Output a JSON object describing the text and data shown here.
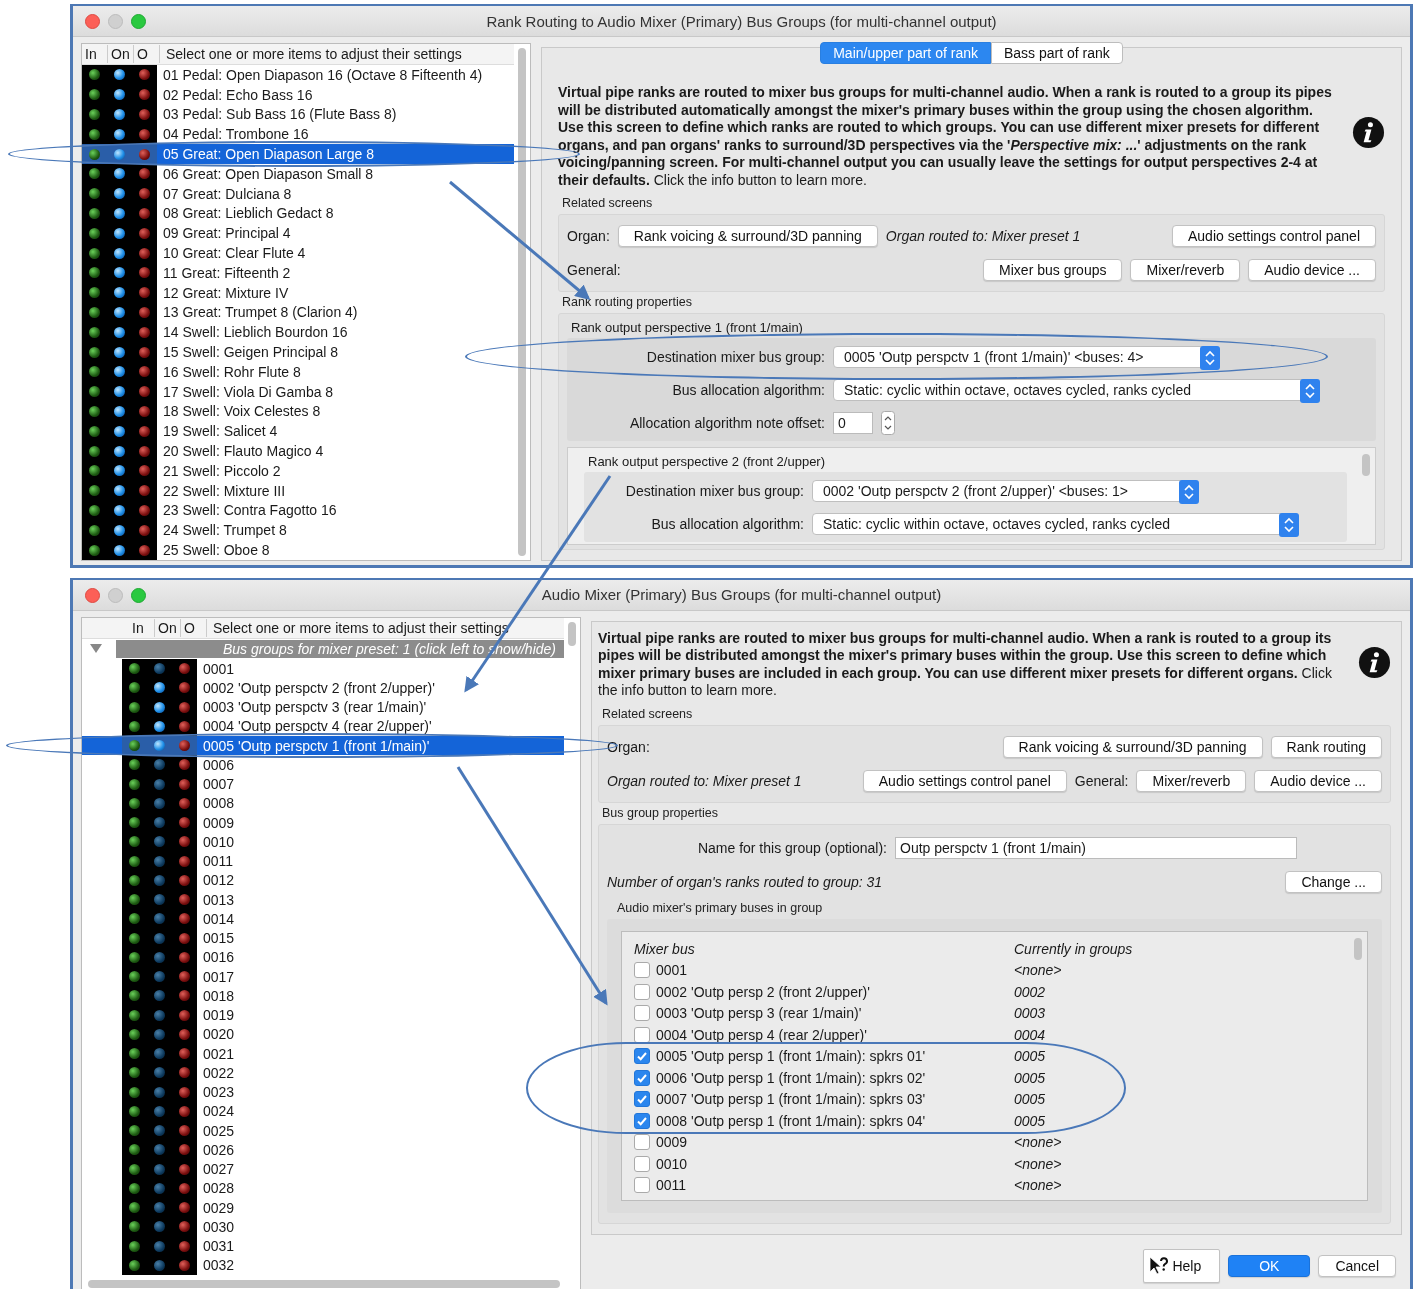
{
  "rank_routing_window": {
    "title": "Rank Routing to Audio Mixer (Primary) Bus Groups (for multi-channel output)",
    "list": {
      "columns": [
        "In",
        "On",
        "O",
        "Select one or more items to adjust their settings"
      ],
      "items": [
        {
          "label": "01 Pedal: Open Diapason 16 (Octave 8 Fifteenth 4)",
          "on": true,
          "selected": false
        },
        {
          "label": "02 Pedal: Echo Bass 16",
          "on": true,
          "selected": false
        },
        {
          "label": "03 Pedal: Sub Bass 16 (Flute Bass 8)",
          "on": true,
          "selected": false
        },
        {
          "label": "04 Pedal: Trombone 16",
          "on": true,
          "selected": false
        },
        {
          "label": "05 Great: Open Diapason Large 8",
          "on": true,
          "selected": true
        },
        {
          "label": "06 Great: Open Diapason Small 8",
          "on": true,
          "selected": false
        },
        {
          "label": "07 Great: Dulciana 8",
          "on": true,
          "selected": false
        },
        {
          "label": "08 Great: Lieblich Gedact 8",
          "on": true,
          "selected": false
        },
        {
          "label": "09 Great: Principal 4",
          "on": true,
          "selected": false
        },
        {
          "label": "10 Great: Clear Flute 4",
          "on": true,
          "selected": false
        },
        {
          "label": "11 Great: Fifteenth 2",
          "on": true,
          "selected": false
        },
        {
          "label": "12 Great: Mixture IV",
          "on": true,
          "selected": false
        },
        {
          "label": "13 Great: Trumpet 8 (Clarion 4)",
          "on": true,
          "selected": false
        },
        {
          "label": "14 Swell: Lieblich Bourdon 16",
          "on": true,
          "selected": false
        },
        {
          "label": "15 Swell: Geigen Principal 8",
          "on": true,
          "selected": false
        },
        {
          "label": "16 Swell: Rohr Flute 8",
          "on": true,
          "selected": false
        },
        {
          "label": "17 Swell: Viola Di Gamba 8",
          "on": true,
          "selected": false
        },
        {
          "label": "18 Swell: Voix Celestes 8",
          "on": true,
          "selected": false
        },
        {
          "label": "19 Swell: Salicet 4",
          "on": true,
          "selected": false
        },
        {
          "label": "20 Swell: Flauto Magico 4",
          "on": true,
          "selected": false
        },
        {
          "label": "21 Swell: Piccolo 2",
          "on": true,
          "selected": false
        },
        {
          "label": "22 Swell: Mixture III",
          "on": true,
          "selected": false
        },
        {
          "label": "23 Swell: Contra Fagotto 16",
          "on": true,
          "selected": false
        },
        {
          "label": "24 Swell: Trumpet 8",
          "on": true,
          "selected": false
        },
        {
          "label": "25 Swell: Oboe 8",
          "on": true,
          "selected": false
        }
      ]
    },
    "tabs": [
      {
        "label": "Main/upper part of rank",
        "selected": true
      },
      {
        "label": "Bass part of rank",
        "selected": false
      }
    ],
    "description": "**Virtual pipe ranks are routed to mixer bus groups for multi-channel audio. When a rank is routed to a group its pipes will be distributed automatically amongst the mixer's primary buses within the group using the chosen algorithm. Use this screen to define which ranks are routed to which groups. You can use different mixer presets for different organs, and pan organs' ranks to surround/3D perspectives via the '*Perspective mix: ...*' adjustments on the rank voicing/panning screen. For multi-channel output you can usually leave the settings for output perspectives 2-4 at their defaults.** Click the info button to learn more.",
    "related_screens": {
      "title": "Related screens",
      "organ_label": "Organ:",
      "organ_buttons": [
        "Rank voicing & surround/3D panning"
      ],
      "organ_routed_to": "Organ routed to:  Mixer preset 1",
      "settings_button": "Audio settings control panel",
      "general_label": "General:",
      "general_buttons": [
        "Mixer bus groups",
        "Mixer/reverb",
        "Audio device ..."
      ]
    },
    "routing_properties": {
      "title": "Rank routing properties",
      "perspectives": [
        {
          "title": "Rank output perspective 1 (front 1/main)",
          "fields": [
            {
              "kind": "select",
              "label": "Destination mixer bus group:",
              "value": "0005 'Outp perspctv 1 (front 1/main)' <buses: 4>"
            },
            {
              "kind": "select",
              "label": "Bus allocation algorithm:",
              "value": "Static: cyclic within octave, octaves cycled, ranks cycled"
            },
            {
              "kind": "stepper",
              "label": "Allocation algorithm note offset:",
              "value": "0"
            }
          ]
        },
        {
          "title": "Rank output perspective 2 (front 2/upper)",
          "fields": [
            {
              "kind": "select",
              "label": "Destination mixer bus group:",
              "value": "0002 'Outp perspctv 2 (front 2/upper)' <buses: 1>"
            },
            {
              "kind": "select",
              "label": "Bus allocation algorithm:",
              "value": "Static: cyclic within octave, octaves cycled, ranks cycled"
            }
          ]
        }
      ]
    }
  },
  "bus_groups_window": {
    "title": "Audio Mixer (Primary) Bus Groups (for multi-channel output)",
    "list": {
      "columns": [
        "In",
        "On",
        "O",
        "Select one or more items to adjust their settings"
      ],
      "group": {
        "label": "Bus groups for mixer preset: 1 (click left to show/hide)",
        "expanded": true
      },
      "items": [
        {
          "label": "0001",
          "on": false,
          "selected": false
        },
        {
          "label": "0002 'Outp perspctv 2 (front 2/upper)'",
          "on": true,
          "selected": false
        },
        {
          "label": "0003 'Outp perspctv 3 (rear 1/main)'",
          "on": true,
          "selected": false
        },
        {
          "label": "0004 'Outp perspctv 4 (rear 2/upper)'",
          "on": true,
          "selected": false
        },
        {
          "label": "0005 'Outp perspctv 1 (front 1/main)'",
          "on": true,
          "selected": true
        },
        {
          "label": "0006",
          "on": false,
          "selected": false
        },
        {
          "label": "0007",
          "on": false,
          "selected": false
        },
        {
          "label": "0008",
          "on": false,
          "selected": false
        },
        {
          "label": "0009",
          "on": false,
          "selected": false
        },
        {
          "label": "0010",
          "on": false,
          "selected": false
        },
        {
          "label": "0011",
          "on": false,
          "selected": false
        },
        {
          "label": "0012",
          "on": false,
          "selected": false
        },
        {
          "label": "0013",
          "on": false,
          "selected": false
        },
        {
          "label": "0014",
          "on": false,
          "selected": false
        },
        {
          "label": "0015",
          "on": false,
          "selected": false
        },
        {
          "label": "0016",
          "on": false,
          "selected": false
        },
        {
          "label": "0017",
          "on": false,
          "selected": false
        },
        {
          "label": "0018",
          "on": false,
          "selected": false
        },
        {
          "label": "0019",
          "on": false,
          "selected": false
        },
        {
          "label": "0020",
          "on": false,
          "selected": false
        },
        {
          "label": "0021",
          "on": false,
          "selected": false
        },
        {
          "label": "0022",
          "on": false,
          "selected": false
        },
        {
          "label": "0023",
          "on": false,
          "selected": false
        },
        {
          "label": "0024",
          "on": false,
          "selected": false
        },
        {
          "label": "0025",
          "on": false,
          "selected": false
        },
        {
          "label": "0026",
          "on": false,
          "selected": false
        },
        {
          "label": "0027",
          "on": false,
          "selected": false
        },
        {
          "label": "0028",
          "on": false,
          "selected": false
        },
        {
          "label": "0029",
          "on": false,
          "selected": false
        },
        {
          "label": "0030",
          "on": false,
          "selected": false
        },
        {
          "label": "0031",
          "on": false,
          "selected": false
        },
        {
          "label": "0032",
          "on": false,
          "selected": false
        }
      ]
    },
    "description": "**Virtual pipe ranks are routed to mixer bus groups for multi-channel audio. When a rank is routed to a group its pipes will be distributed amongst the mixer's primary buses within the group. Use this screen to define which mixer primary buses are included in each group. You can use different mixer presets for different organs.** Click the info button to learn more.",
    "related_screens": {
      "title": "Related screens",
      "organ_label": "Organ:",
      "organ_buttons": [
        "Rank voicing & surround/3D panning",
        "Rank routing"
      ],
      "organ_routed_to": "Organ routed to: Mixer preset 1",
      "settings_button": "Audio settings control panel",
      "general_label": "General:",
      "general_buttons": [
        "Mixer/reverb",
        "Audio device ..."
      ]
    },
    "bus_group_properties": {
      "title": "Bus group properties",
      "name_label": "Name for this group (optional):",
      "name_value": "Outp perspctv 1 (front 1/main)",
      "ranks_routed": "Number of organ's ranks routed to group:  31",
      "change_button": "Change ...",
      "buses": {
        "title": "Audio mixer's primary buses in group",
        "columns": [
          "Mixer bus",
          "Currently in groups"
        ],
        "rows": [
          {
            "bus": "0001",
            "groups": "<none>",
            "checked": false
          },
          {
            "bus": "0002 'Outp persp 2 (front 2/upper)'",
            "groups": "0002",
            "checked": false
          },
          {
            "bus": "0003 'Outp persp 3 (rear 1/main)'",
            "groups": "0003",
            "checked": false
          },
          {
            "bus": "0004 'Outp persp 4 (rear 2/upper)'",
            "groups": "0004",
            "checked": false
          },
          {
            "bus": "0005 'Outp persp 1 (front 1/main): spkrs 01'",
            "groups": "0005",
            "checked": true
          },
          {
            "bus": "0006 'Outp persp 1 (front 1/main): spkrs 02'",
            "groups": "0005",
            "checked": true
          },
          {
            "bus": "0007 'Outp persp 1 (front 1/main): spkrs 03'",
            "groups": "0005",
            "checked": true
          },
          {
            "bus": "0008 'Outp persp 1 (front 1/main): spkrs 04'",
            "groups": "0005",
            "checked": true
          },
          {
            "bus": "0009",
            "groups": "<none>",
            "checked": false
          },
          {
            "bus": "0010",
            "groups": "<none>",
            "checked": false
          },
          {
            "bus": "0011",
            "groups": "<none>",
            "checked": false
          }
        ]
      }
    },
    "buttons": {
      "help": "Help",
      "ok": "OK",
      "cancel": "Cancel"
    }
  }
}
